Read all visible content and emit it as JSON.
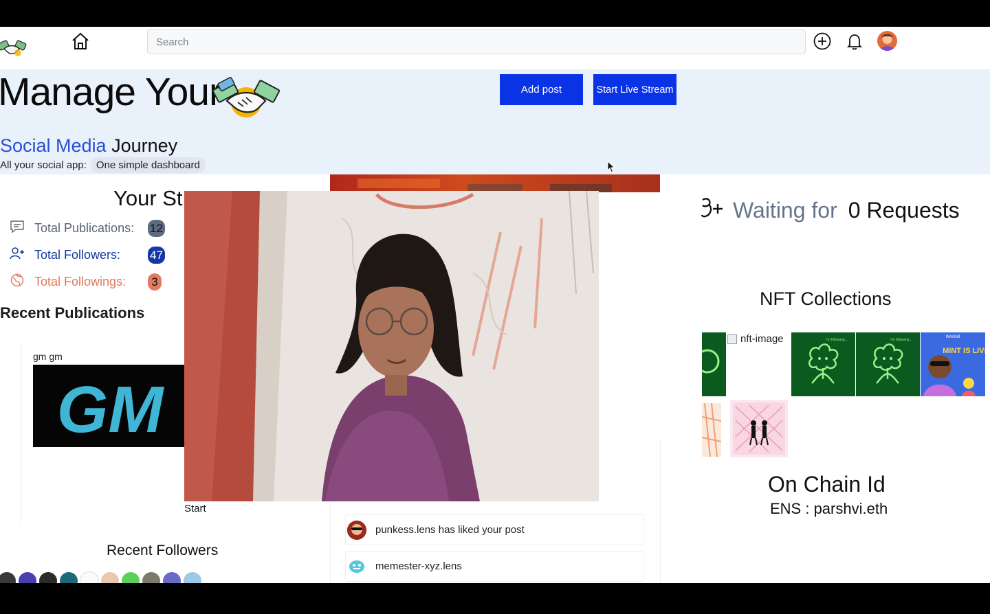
{
  "navbar": {
    "search_placeholder": "Search",
    "icons": [
      "handshake-logo-icon",
      "home-icon",
      "plus-circle-icon",
      "bell-icon",
      "user-avatar"
    ]
  },
  "hero": {
    "title": "Manage Your",
    "subtitle_accent": "Social Media",
    "subtitle_rest": "Journey",
    "tagline_prefix": "All your social app:",
    "tagline_pill": "One simple dashboard",
    "add_post_label": "Add post",
    "live_stream_label": "Start Live Stream"
  },
  "stats": {
    "title": "Your St",
    "items": [
      {
        "label": "Total Publications:",
        "count": "12",
        "icon": "comment-icon"
      },
      {
        "label": "Total Followers:",
        "count": "47",
        "icon": "user-plus-icon"
      },
      {
        "label": "Total Followings:",
        "count": "3",
        "icon": "globe-icon"
      }
    ]
  },
  "recent_publications": {
    "title": "Recent Publications",
    "items": [
      {
        "text": "gm gm",
        "image_text": "GM"
      }
    ]
  },
  "video": {
    "label": "Start"
  },
  "notifications": [
    {
      "text": "punkess.lens has liked your post"
    },
    {
      "text": "memester-xyz.lens"
    }
  ],
  "recent_followers": {
    "title": "Recent Followers",
    "count_visible": 10
  },
  "requests": {
    "label": "Waiting for",
    "count": "0 Requests"
  },
  "nft": {
    "title": "NFT Collections",
    "broken_alt": "nft-image",
    "items": [
      {
        "caption": "I'm following..."
      },
      {
        "caption": "I'm following..."
      },
      {
        "caption": "I'm following..."
      },
      {
        "caption": "WAGMI",
        "badge": "MINT IS LIVE"
      }
    ]
  },
  "onchain": {
    "title": "On Chain Id",
    "ens": "ENS : parshvi.eth"
  },
  "colors": {
    "primary_button": "#0a33e6",
    "hero_bg": "#e9f1fb",
    "accent_blue": "#2b4fd1",
    "nft_green": "#0b5a1f"
  }
}
